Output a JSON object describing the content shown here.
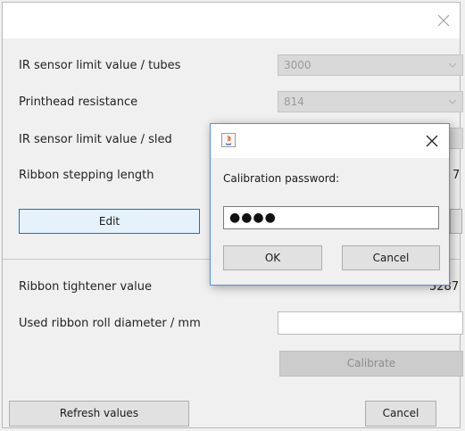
{
  "window": {
    "close_icon": "close-icon"
  },
  "settings": {
    "ir_tubes": {
      "label": "IR sensor limit value / tubes",
      "value": "3000"
    },
    "printhead": {
      "label": "Printhead resistance",
      "value": "814"
    },
    "ir_sled": {
      "label": "IR sensor limit value / sled"
    },
    "ribbon_step": {
      "label": "Ribbon stepping length",
      "value_partial": "7"
    },
    "edit_button": "Edit"
  },
  "calibration": {
    "tightener": {
      "label": "Ribbon tightener value",
      "value_partial": "5287"
    },
    "roll_diameter": {
      "label": "Used ribbon roll diameter / mm",
      "value": ""
    },
    "calibrate_button": "Calibrate"
  },
  "footer": {
    "refresh_button": "Refresh values",
    "cancel_button": "Cancel"
  },
  "password_dialog": {
    "icon": "java-icon",
    "prompt": "Calibration password:",
    "password_masked": "●●●●",
    "ok_button": "OK",
    "cancel_button": "Cancel"
  },
  "colors": {
    "focus_border": "#0078d7",
    "focus_fill": "#e5f1fb",
    "dialog_border": "#5a8fd6"
  }
}
